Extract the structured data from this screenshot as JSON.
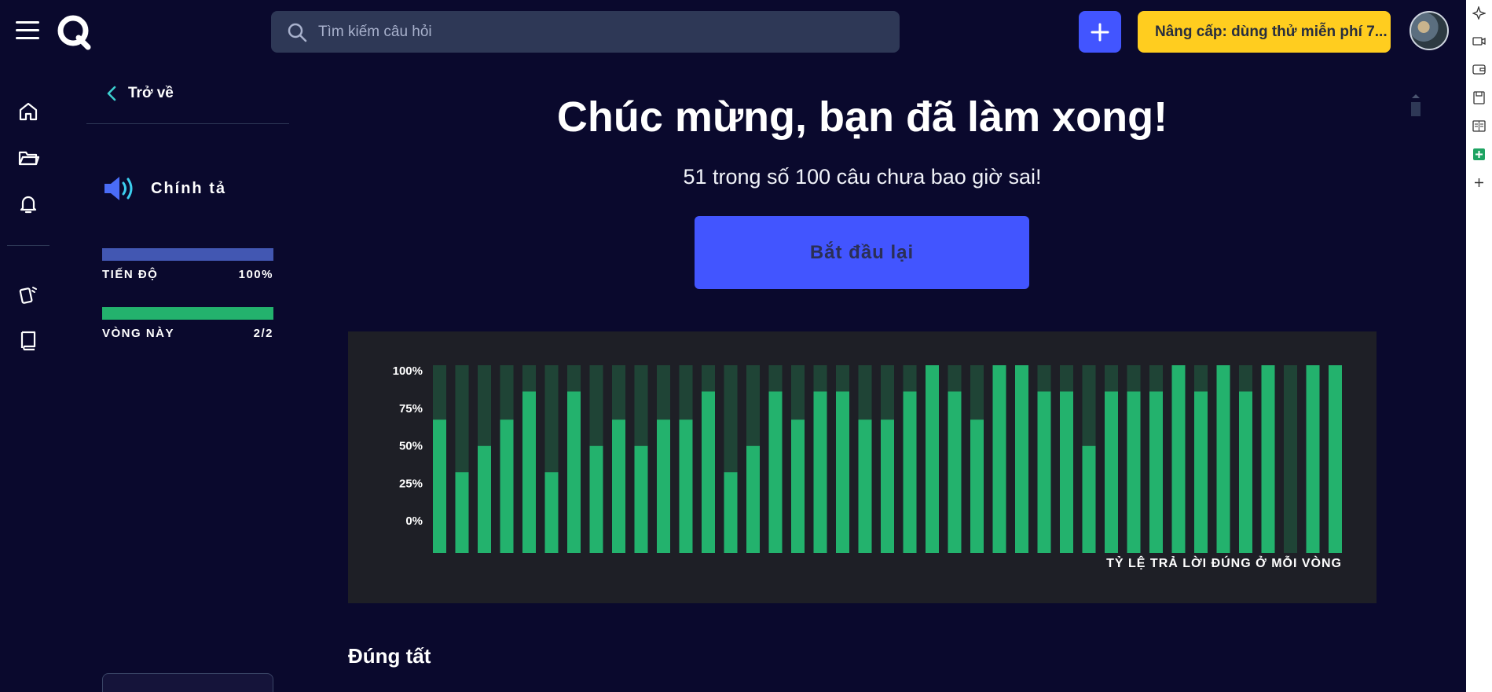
{
  "topbar": {
    "search_placeholder": "Tìm kiếm câu hỏi",
    "upgrade_label": "Nâng cấp: dùng thử miễn phí 7..."
  },
  "sidebar": {
    "back_label": "Trở về",
    "mode_label": "Chính tả",
    "progress_label": "TIẾN ĐỘ",
    "progress_value": "100%",
    "progress_fraction": 1.0,
    "round_label": "VÒNG NÀY",
    "round_value": "2/2",
    "round_fraction": 1.0
  },
  "main": {
    "headline": "Chúc mừng, bạn đã làm xong!",
    "subline": "51 trong số 100 câu chưa bao giờ sai!",
    "restart_label": "Bắt đầu lại",
    "section_title": "Đúng tất"
  },
  "colors": {
    "background": "#0a092d",
    "accent": "#4255ff",
    "upgrade": "#ffcd1f",
    "bar_correct": "#23b26d",
    "bar_track": "#1f4436",
    "progress_bar": "#4257b2"
  },
  "chart_data": {
    "type": "bar",
    "title": "",
    "xlabel": "TỶ LỆ TRẢ LỜI ĐÚNG Ở MỖI VÒNG",
    "ylabel": "",
    "ylim": [
      0,
      100
    ],
    "y_tick_labels": [
      "100%",
      "75%",
      "50%",
      "25%",
      "0%"
    ],
    "values": [
      71,
      43,
      57,
      71,
      86,
      43,
      86,
      57,
      71,
      57,
      71,
      71,
      86,
      43,
      57,
      86,
      71,
      86,
      86,
      71,
      71,
      86,
      100,
      86,
      71,
      100,
      100,
      86,
      86,
      57,
      86,
      86,
      86,
      100,
      86,
      100,
      86,
      100,
      0,
      100,
      100
    ]
  }
}
